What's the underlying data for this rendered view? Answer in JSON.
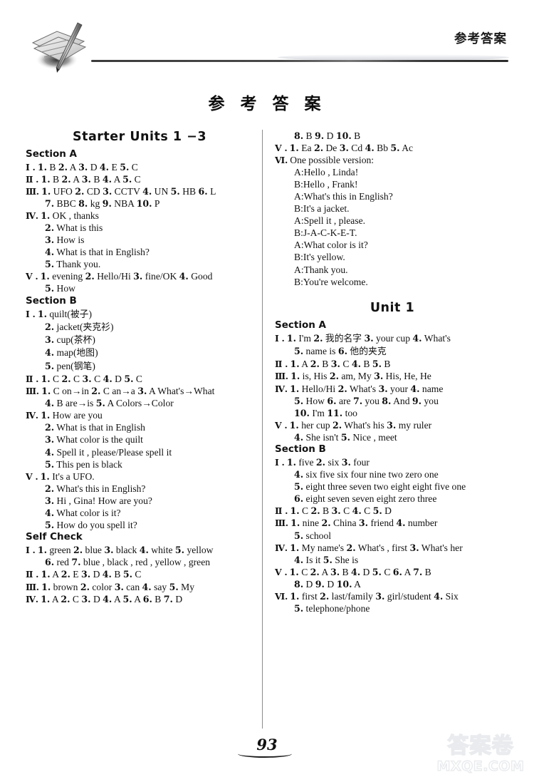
{
  "header": {
    "title": "参考答案",
    "logo_icon": "pencil-on-paper-icon"
  },
  "main_title": "参 考 答 案",
  "footer": {
    "page_number": "93",
    "watermark_cjk": "答案卷",
    "watermark_domain": "MXQE.COM"
  },
  "left_column": {
    "unit_title": "Starter Units 1 −3",
    "blocks": [
      {
        "type": "section",
        "label": "Section A"
      },
      {
        "type": "line",
        "roman": "Ⅰ .",
        "text": "1. B   2. A   3. D   4. E   5. C"
      },
      {
        "type": "line",
        "roman": "Ⅱ .",
        "text": "1. B   2. A   3. B   4. A   5. C"
      },
      {
        "type": "line",
        "roman": "Ⅲ.",
        "text": "1. UFO   2. CD   3. CCTV   4. UN   5. HB   6. L"
      },
      {
        "type": "line",
        "roman": "",
        "indent": true,
        "text": "7. BBC   8. kg   9. NBA   10. P"
      },
      {
        "type": "line",
        "roman": "Ⅳ.",
        "text": "1. OK , thanks"
      },
      {
        "type": "line",
        "roman": "",
        "indent": true,
        "text": "2. What is this"
      },
      {
        "type": "line",
        "roman": "",
        "indent": true,
        "text": "3. How is"
      },
      {
        "type": "line",
        "roman": "",
        "indent": true,
        "text": "4. What is that in English?"
      },
      {
        "type": "line",
        "roman": "",
        "indent": true,
        "text": "5. Thank you."
      },
      {
        "type": "line",
        "roman": "Ⅴ .",
        "text": "1. evening   2. Hello/Hi   3. fine/OK   4. Good"
      },
      {
        "type": "line",
        "roman": "",
        "indent": true,
        "text": "5. How"
      },
      {
        "type": "section",
        "label": "Section B"
      },
      {
        "type": "line",
        "roman": "Ⅰ .",
        "text": "1. quilt(被子)"
      },
      {
        "type": "line",
        "roman": "",
        "indent": true,
        "text": "2. jacket(夹克衫)"
      },
      {
        "type": "line",
        "roman": "",
        "indent": true,
        "text": "3. cup(茶杯)"
      },
      {
        "type": "line",
        "roman": "",
        "indent": true,
        "text": "4. map(地图)"
      },
      {
        "type": "line",
        "roman": "",
        "indent": true,
        "text": "5. pen(钢笔)"
      },
      {
        "type": "line",
        "roman": "Ⅱ .",
        "text": "1. C   2. C   3. C   4. D   5. C"
      },
      {
        "type": "line",
        "roman": "Ⅲ.",
        "text": "1. C on→in   2. C an→a   3. A What's→What"
      },
      {
        "type": "line",
        "roman": "",
        "indent": true,
        "text": "4. B are→is   5. A Colors→Color"
      },
      {
        "type": "line",
        "roman": "Ⅳ.",
        "text": "1. How are you"
      },
      {
        "type": "line",
        "roman": "",
        "indent": true,
        "text": "2. What is that in English"
      },
      {
        "type": "line",
        "roman": "",
        "indent": true,
        "text": "3. What color is the quilt"
      },
      {
        "type": "line",
        "roman": "",
        "indent": true,
        "text": "4. Spell it , please/Please spell it"
      },
      {
        "type": "line",
        "roman": "",
        "indent": true,
        "text": "5. This pen is black"
      },
      {
        "type": "line",
        "roman": "Ⅴ .",
        "text": "1. It's a UFO."
      },
      {
        "type": "line",
        "roman": "",
        "indent": true,
        "text": "2. What's this in English?"
      },
      {
        "type": "line",
        "roman": "",
        "indent": true,
        "text": "3. Hi , Gina!  How are you?"
      },
      {
        "type": "line",
        "roman": "",
        "indent": true,
        "text": "4. What color is it?"
      },
      {
        "type": "line",
        "roman": "",
        "indent": true,
        "text": "5. How do you spell it?"
      },
      {
        "type": "section",
        "label": "Self Check"
      },
      {
        "type": "line",
        "roman": "Ⅰ .",
        "text": "1. green   2. blue   3. black   4. white   5. yellow"
      },
      {
        "type": "line",
        "roman": "",
        "indent": true,
        "text": "6. red   7. blue , black , red , yellow , green"
      },
      {
        "type": "line",
        "roman": "Ⅱ .",
        "text": "1. A   2. E   3. D   4. B   5. C"
      },
      {
        "type": "line",
        "roman": "Ⅲ.",
        "text": "1. brown   2. color   3. can   4. say   5. My"
      },
      {
        "type": "line",
        "roman": "Ⅳ.",
        "text": "1. A   2. C   3. D   4. A   5. A   6. B   7. D"
      }
    ]
  },
  "right_column": {
    "blocks": [
      {
        "type": "line",
        "roman": "",
        "indent": true,
        "text": "8. B   9. D   10. B"
      },
      {
        "type": "line",
        "roman": "Ⅴ .",
        "text": "1. Ea   2. De   3. Cd   4. Bb   5. Ac"
      },
      {
        "type": "line",
        "roman": "Ⅵ.",
        "text": "One possible version:"
      },
      {
        "type": "line",
        "roman": "",
        "indent": true,
        "text": "A:Hello , Linda!"
      },
      {
        "type": "line",
        "roman": "",
        "indent": true,
        "text": "B:Hello , Frank!"
      },
      {
        "type": "line",
        "roman": "",
        "indent": true,
        "text": "A:What's this in English?"
      },
      {
        "type": "line",
        "roman": "",
        "indent": true,
        "text": "B:It's a jacket."
      },
      {
        "type": "line",
        "roman": "",
        "indent": true,
        "text": "A:Spell it , please."
      },
      {
        "type": "line",
        "roman": "",
        "indent": true,
        "text": "B:J-A-C-K-E-T."
      },
      {
        "type": "line",
        "roman": "",
        "indent": true,
        "text": "A:What color is it?"
      },
      {
        "type": "line",
        "roman": "",
        "indent": true,
        "text": "B:It's yellow."
      },
      {
        "type": "line",
        "roman": "",
        "indent": true,
        "text": "A:Thank you."
      },
      {
        "type": "line",
        "roman": "",
        "indent": true,
        "text": "B:You're welcome."
      },
      {
        "type": "unit",
        "label": "Unit 1"
      },
      {
        "type": "section",
        "label": "Section A"
      },
      {
        "type": "line",
        "roman": "Ⅰ .",
        "text": "1. I'm   2. 我的名字   3. your cup   4. What's"
      },
      {
        "type": "line",
        "roman": "",
        "indent": true,
        "text": "5. name is   6. 他的夹克"
      },
      {
        "type": "line",
        "roman": "Ⅱ .",
        "text": "1. A   2. B   3. C   4. B   5. B"
      },
      {
        "type": "line",
        "roman": "Ⅲ.",
        "text": "1. is, His   2. am, My   3. His, He, He"
      },
      {
        "type": "line",
        "roman": "Ⅳ.",
        "text": "1. Hello/Hi   2. What's   3. your   4. name"
      },
      {
        "type": "line",
        "roman": "",
        "indent": true,
        "text": "5. How   6. are   7. you   8. And   9. you"
      },
      {
        "type": "line",
        "roman": "",
        "indent": true,
        "text": "10. I'm   11. too"
      },
      {
        "type": "line",
        "roman": "Ⅴ .",
        "text": "1. her cup   2. What's his   3. my ruler"
      },
      {
        "type": "line",
        "roman": "",
        "indent": true,
        "text": "4. She isn't   5. Nice , meet"
      },
      {
        "type": "section",
        "label": "Section B"
      },
      {
        "type": "line",
        "roman": "Ⅰ .",
        "text": "1. five   2. six   3. four"
      },
      {
        "type": "line",
        "roman": "",
        "indent": true,
        "text": "4. six five six four nine two zero one"
      },
      {
        "type": "line",
        "roman": "",
        "indent": true,
        "text": "5. eight three seven two eight eight five one"
      },
      {
        "type": "line",
        "roman": "",
        "indent": true,
        "text": "6. eight seven seven eight zero three"
      },
      {
        "type": "line",
        "roman": "Ⅱ .",
        "text": "1. C   2. B   3. C   4. C   5. D"
      },
      {
        "type": "line",
        "roman": "Ⅲ.",
        "text": "1. nine   2. China   3. friend   4. number"
      },
      {
        "type": "line",
        "roman": "",
        "indent": true,
        "text": "5. school"
      },
      {
        "type": "line",
        "roman": "Ⅳ.",
        "text": "1. My name's   2. What's , first   3. What's her"
      },
      {
        "type": "line",
        "roman": "",
        "indent": true,
        "text": "4. Is it   5. She is"
      },
      {
        "type": "line",
        "roman": "Ⅴ .",
        "text": "1. C   2. A   3. B   4. D   5. C   6. A   7. B"
      },
      {
        "type": "line",
        "roman": "",
        "indent": true,
        "text": "8. D   9. D   10. A"
      },
      {
        "type": "line",
        "roman": "Ⅵ.",
        "text": "1. first   2. last/family   3. girl/student   4. Six"
      },
      {
        "type": "line",
        "roman": "",
        "indent": true,
        "text": "5. telephone/phone"
      }
    ]
  }
}
